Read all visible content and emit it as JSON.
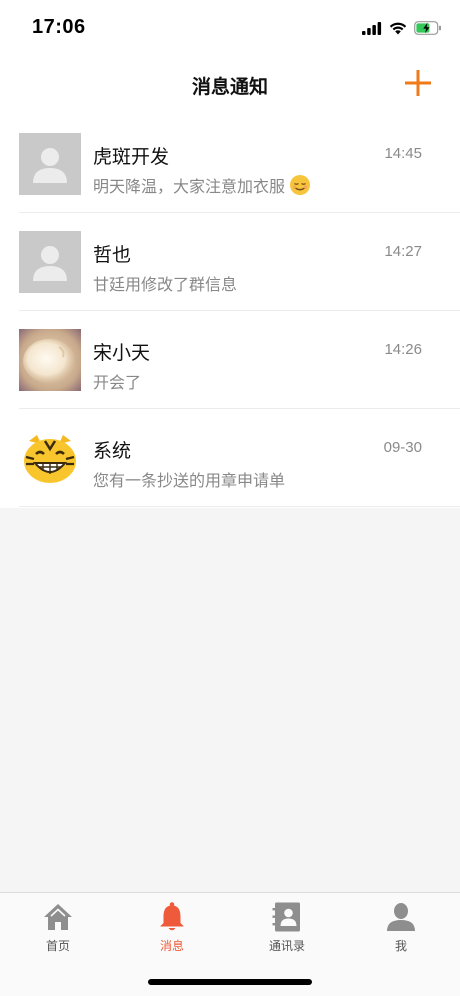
{
  "status_bar": {
    "time": "17:06"
  },
  "header": {
    "title": "消息通知"
  },
  "conversations": [
    {
      "name": "虎斑开发",
      "time": "14:45",
      "preview": "明天降温，大家注意加衣服",
      "preview_emoji": "relieved-face-icon",
      "avatar": "default-avatar-icon"
    },
    {
      "name": "哲也",
      "time": "14:27",
      "preview": "甘廷用修改了群信息",
      "avatar": "default-avatar-icon"
    },
    {
      "name": "宋小天",
      "time": "14:26",
      "preview": "开会了",
      "avatar": "fluffy-cat-photo"
    },
    {
      "name": "系统",
      "time": "09-30",
      "preview": "您有一条抄送的用章申请单",
      "avatar": "tiger-face-icon"
    }
  ],
  "tabs": [
    {
      "label": "首页",
      "icon": "home-icon"
    },
    {
      "label": "消息",
      "icon": "bell-icon",
      "active": true
    },
    {
      "label": "通讯录",
      "icon": "contacts-book-icon"
    },
    {
      "label": "我",
      "icon": "person-icon"
    }
  ],
  "colors": {
    "accent": "#f07a1a",
    "tab_active": "#ef5b3a",
    "tab_inactive": "#8e8e8e"
  }
}
